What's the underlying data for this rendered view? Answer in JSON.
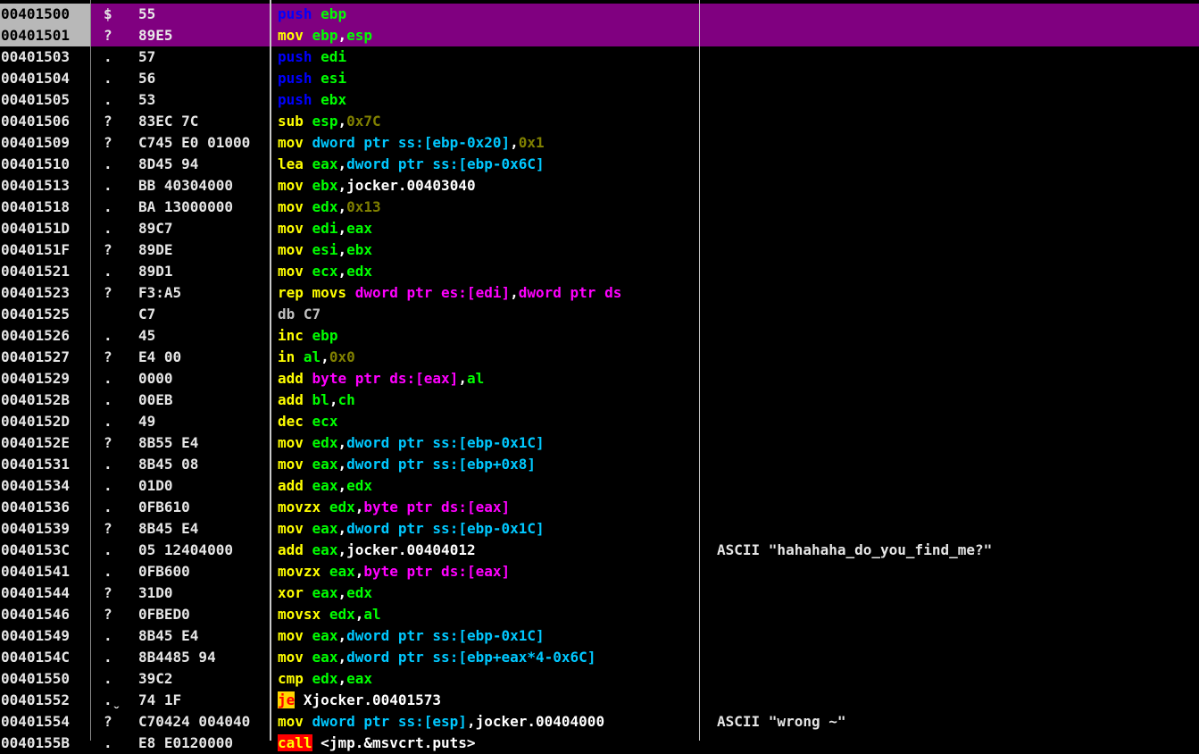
{
  "colors": {
    "background": "#000000",
    "selection": "#800080",
    "mnemonic_push": "#0000ff",
    "mnemonic_default": "#ffff00",
    "register": "#00ff00",
    "memory": "#ff00ff",
    "memory_segment": "#00c8ff",
    "immediate": "#808000",
    "symbol": "#ffffff",
    "undefined": "#c0c0c0",
    "jump_highlight_bg": "#ffd700",
    "jump_highlight_fg": "#ff0000",
    "call_bg": "#ff0000",
    "call_fg": "#ffff00"
  },
  "rows": [
    {
      "addr": "00401500",
      "mark": "$",
      "hex": "55",
      "selected": true,
      "asm": [
        [
          "push",
          "push"
        ],
        [
          "sp",
          " "
        ],
        [
          "reg",
          "ebp"
        ]
      ],
      "comment": ""
    },
    {
      "addr": "00401501",
      "mark": "?",
      "hex": "89E5",
      "selected": true,
      "asm": [
        [
          "mn",
          "mov"
        ],
        [
          "sp",
          " "
        ],
        [
          "reg",
          "ebp"
        ],
        [
          "pn",
          ","
        ],
        [
          "reg",
          "esp"
        ]
      ],
      "comment": ""
    },
    {
      "addr": "00401503",
      "mark": ".",
      "hex": "57",
      "selected": false,
      "asm": [
        [
          "push",
          "push"
        ],
        [
          "sp",
          " "
        ],
        [
          "reg",
          "edi"
        ]
      ],
      "comment": ""
    },
    {
      "addr": "00401504",
      "mark": ".",
      "hex": "56",
      "selected": false,
      "asm": [
        [
          "push",
          "push"
        ],
        [
          "sp",
          " "
        ],
        [
          "reg",
          "esi"
        ]
      ],
      "comment": ""
    },
    {
      "addr": "00401505",
      "mark": ".",
      "hex": "53",
      "selected": false,
      "asm": [
        [
          "push",
          "push"
        ],
        [
          "sp",
          " "
        ],
        [
          "reg",
          "ebx"
        ]
      ],
      "comment": ""
    },
    {
      "addr": "00401506",
      "mark": "?",
      "hex": "83EC 7C",
      "selected": false,
      "asm": [
        [
          "mn",
          "sub"
        ],
        [
          "sp",
          " "
        ],
        [
          "reg",
          "esp"
        ],
        [
          "pn",
          ","
        ],
        [
          "imm",
          "0x7C"
        ]
      ],
      "comment": ""
    },
    {
      "addr": "00401509",
      "mark": "?",
      "hex": "C745 E0 01000",
      "selected": false,
      "asm": [
        [
          "mn",
          "mov"
        ],
        [
          "sp",
          " "
        ],
        [
          "seg",
          "dword ptr ss:[ebp-0x20]"
        ],
        [
          "pn",
          ","
        ],
        [
          "imm",
          "0x1"
        ]
      ],
      "comment": ""
    },
    {
      "addr": "00401510",
      "mark": ".",
      "hex": "8D45 94",
      "selected": false,
      "asm": [
        [
          "mn",
          "lea"
        ],
        [
          "sp",
          " "
        ],
        [
          "reg",
          "eax"
        ],
        [
          "pn",
          ","
        ],
        [
          "seg",
          "dword ptr ss:[ebp-0x6C]"
        ]
      ],
      "comment": ""
    },
    {
      "addr": "00401513",
      "mark": ".",
      "hex": "BB 40304000",
      "selected": false,
      "asm": [
        [
          "mn",
          "mov"
        ],
        [
          "sp",
          " "
        ],
        [
          "reg",
          "ebx"
        ],
        [
          "pn",
          ","
        ],
        [
          "sym",
          "jocker.00403040"
        ]
      ],
      "comment": ""
    },
    {
      "addr": "00401518",
      "mark": ".",
      "hex": "BA 13000000",
      "selected": false,
      "asm": [
        [
          "mn",
          "mov"
        ],
        [
          "sp",
          " "
        ],
        [
          "reg",
          "edx"
        ],
        [
          "pn",
          ","
        ],
        [
          "imm",
          "0x13"
        ]
      ],
      "comment": ""
    },
    {
      "addr": "0040151D",
      "mark": ".",
      "hex": "89C7",
      "selected": false,
      "asm": [
        [
          "mn",
          "mov"
        ],
        [
          "sp",
          " "
        ],
        [
          "reg",
          "edi"
        ],
        [
          "pn",
          ","
        ],
        [
          "reg",
          "eax"
        ]
      ],
      "comment": ""
    },
    {
      "addr": "0040151F",
      "mark": "?",
      "hex": "89DE",
      "selected": false,
      "asm": [
        [
          "mn",
          "mov"
        ],
        [
          "sp",
          " "
        ],
        [
          "reg",
          "esi"
        ],
        [
          "pn",
          ","
        ],
        [
          "reg",
          "ebx"
        ]
      ],
      "comment": ""
    },
    {
      "addr": "00401521",
      "mark": ".",
      "hex": "89D1",
      "selected": false,
      "asm": [
        [
          "mn",
          "mov"
        ],
        [
          "sp",
          " "
        ],
        [
          "reg",
          "ecx"
        ],
        [
          "pn",
          ","
        ],
        [
          "reg",
          "edx"
        ]
      ],
      "comment": ""
    },
    {
      "addr": "00401523",
      "mark": "?",
      "hex": "F3:A5",
      "selected": false,
      "asm": [
        [
          "mn",
          "rep movs"
        ],
        [
          "sp",
          " "
        ],
        [
          "mem",
          "dword ptr es:[edi]"
        ],
        [
          "pn",
          ","
        ],
        [
          "mem",
          "dword ptr ds"
        ]
      ],
      "comment": ""
    },
    {
      "addr": "00401525",
      "mark": "",
      "hex": "C7",
      "selected": false,
      "asm": [
        [
          "und",
          "db C7"
        ]
      ],
      "comment": ""
    },
    {
      "addr": "00401526",
      "mark": ".",
      "hex": "45",
      "selected": false,
      "asm": [
        [
          "mn",
          "inc"
        ],
        [
          "sp",
          " "
        ],
        [
          "reg",
          "ebp"
        ]
      ],
      "comment": ""
    },
    {
      "addr": "00401527",
      "mark": "?",
      "hex": "E4 00",
      "selected": false,
      "asm": [
        [
          "mn",
          "in"
        ],
        [
          "sp",
          " "
        ],
        [
          "reg",
          "al"
        ],
        [
          "pn",
          ","
        ],
        [
          "imm",
          "0x0"
        ]
      ],
      "comment": ""
    },
    {
      "addr": "00401529",
      "mark": ".",
      "hex": "0000",
      "selected": false,
      "asm": [
        [
          "mn",
          "add"
        ],
        [
          "sp",
          " "
        ],
        [
          "mem",
          "byte ptr ds:[eax]"
        ],
        [
          "pn",
          ","
        ],
        [
          "reg",
          "al"
        ]
      ],
      "comment": ""
    },
    {
      "addr": "0040152B",
      "mark": ".",
      "hex": "00EB",
      "selected": false,
      "asm": [
        [
          "mn",
          "add"
        ],
        [
          "sp",
          " "
        ],
        [
          "reg",
          "bl"
        ],
        [
          "pn",
          ","
        ],
        [
          "reg",
          "ch"
        ]
      ],
      "comment": ""
    },
    {
      "addr": "0040152D",
      "mark": ".",
      "hex": "49",
      "selected": false,
      "asm": [
        [
          "mn",
          "dec"
        ],
        [
          "sp",
          " "
        ],
        [
          "reg",
          "ecx"
        ]
      ],
      "comment": ""
    },
    {
      "addr": "0040152E",
      "mark": "?",
      "hex": "8B55 E4",
      "selected": false,
      "asm": [
        [
          "mn",
          "mov"
        ],
        [
          "sp",
          " "
        ],
        [
          "reg",
          "edx"
        ],
        [
          "pn",
          ","
        ],
        [
          "seg",
          "dword ptr ss:[ebp-0x1C]"
        ]
      ],
      "comment": ""
    },
    {
      "addr": "00401531",
      "mark": ".",
      "hex": "8B45 08",
      "selected": false,
      "asm": [
        [
          "mn",
          "mov"
        ],
        [
          "sp",
          " "
        ],
        [
          "reg",
          "eax"
        ],
        [
          "pn",
          ","
        ],
        [
          "seg",
          "dword ptr ss:[ebp+0x8]"
        ]
      ],
      "comment": ""
    },
    {
      "addr": "00401534",
      "mark": ".",
      "hex": "01D0",
      "selected": false,
      "asm": [
        [
          "mn",
          "add"
        ],
        [
          "sp",
          " "
        ],
        [
          "reg",
          "eax"
        ],
        [
          "pn",
          ","
        ],
        [
          "reg",
          "edx"
        ]
      ],
      "comment": ""
    },
    {
      "addr": "00401536",
      "mark": ".",
      "hex": "0FB610",
      "selected": false,
      "asm": [
        [
          "mn",
          "movzx"
        ],
        [
          "sp",
          " "
        ],
        [
          "reg",
          "edx"
        ],
        [
          "pn",
          ","
        ],
        [
          "mem",
          "byte ptr ds:[eax]"
        ]
      ],
      "comment": ""
    },
    {
      "addr": "00401539",
      "mark": "?",
      "hex": "8B45 E4",
      "selected": false,
      "asm": [
        [
          "mn",
          "mov"
        ],
        [
          "sp",
          " "
        ],
        [
          "reg",
          "eax"
        ],
        [
          "pn",
          ","
        ],
        [
          "seg",
          "dword ptr ss:[ebp-0x1C]"
        ]
      ],
      "comment": ""
    },
    {
      "addr": "0040153C",
      "mark": ".",
      "hex": "05 12404000",
      "selected": false,
      "asm": [
        [
          "mn",
          "add"
        ],
        [
          "sp",
          " "
        ],
        [
          "reg",
          "eax"
        ],
        [
          "pn",
          ","
        ],
        [
          "sym",
          "jocker.00404012"
        ]
      ],
      "comment": "ASCII \"hahahaha_do_you_find_me?\""
    },
    {
      "addr": "00401541",
      "mark": ".",
      "hex": "0FB600",
      "selected": false,
      "asm": [
        [
          "mn",
          "movzx"
        ],
        [
          "sp",
          " "
        ],
        [
          "reg",
          "eax"
        ],
        [
          "pn",
          ","
        ],
        [
          "mem",
          "byte ptr ds:[eax]"
        ]
      ],
      "comment": ""
    },
    {
      "addr": "00401544",
      "mark": "?",
      "hex": "31D0",
      "selected": false,
      "asm": [
        [
          "mn",
          "xor"
        ],
        [
          "sp",
          " "
        ],
        [
          "reg",
          "eax"
        ],
        [
          "pn",
          ","
        ],
        [
          "reg",
          "edx"
        ]
      ],
      "comment": ""
    },
    {
      "addr": "00401546",
      "mark": "?",
      "hex": "0FBED0",
      "selected": false,
      "asm": [
        [
          "mn",
          "movsx"
        ],
        [
          "sp",
          " "
        ],
        [
          "reg",
          "edx"
        ],
        [
          "pn",
          ","
        ],
        [
          "reg",
          "al"
        ]
      ],
      "comment": ""
    },
    {
      "addr": "00401549",
      "mark": ".",
      "hex": "8B45 E4",
      "selected": false,
      "asm": [
        [
          "mn",
          "mov"
        ],
        [
          "sp",
          " "
        ],
        [
          "reg",
          "eax"
        ],
        [
          "pn",
          ","
        ],
        [
          "seg",
          "dword ptr ss:[ebp-0x1C]"
        ]
      ],
      "comment": ""
    },
    {
      "addr": "0040154C",
      "mark": ".",
      "hex": "8B4485 94",
      "selected": false,
      "asm": [
        [
          "mn",
          "mov"
        ],
        [
          "sp",
          " "
        ],
        [
          "reg",
          "eax"
        ],
        [
          "pn",
          ","
        ],
        [
          "seg",
          "dword ptr ss:[ebp+eax*4-0x6C]"
        ]
      ],
      "comment": ""
    },
    {
      "addr": "00401550",
      "mark": ".",
      "hex": "39C2",
      "selected": false,
      "asm": [
        [
          "mn",
          "cmp"
        ],
        [
          "sp",
          " "
        ],
        [
          "reg",
          "edx"
        ],
        [
          "pn",
          ","
        ],
        [
          "reg",
          "eax"
        ]
      ],
      "comment": ""
    },
    {
      "addr": "00401552",
      "mark": ".ˬ",
      "hex": "74 1F",
      "selected": false,
      "asm": [
        [
          "jmp",
          "je"
        ],
        [
          "sp",
          " "
        ],
        [
          "sym",
          "Xjocker.00401573"
        ]
      ],
      "comment": ""
    },
    {
      "addr": "00401554",
      "mark": "?",
      "hex": "C70424 004040",
      "selected": false,
      "asm": [
        [
          "mn",
          "mov"
        ],
        [
          "sp",
          " "
        ],
        [
          "seg",
          "dword ptr ss:[esp]"
        ],
        [
          "pn",
          ","
        ],
        [
          "sym",
          "jocker.00404000"
        ]
      ],
      "comment": "ASCII \"wrong ~\""
    },
    {
      "addr": "0040155B",
      "mark": ".",
      "hex": "E8 E0120000",
      "selected": false,
      "asm": [
        [
          "call",
          "call"
        ],
        [
          "sp",
          " "
        ],
        [
          "sym",
          "<jmp.&msvcrt.puts>"
        ]
      ],
      "comment": ""
    }
  ]
}
